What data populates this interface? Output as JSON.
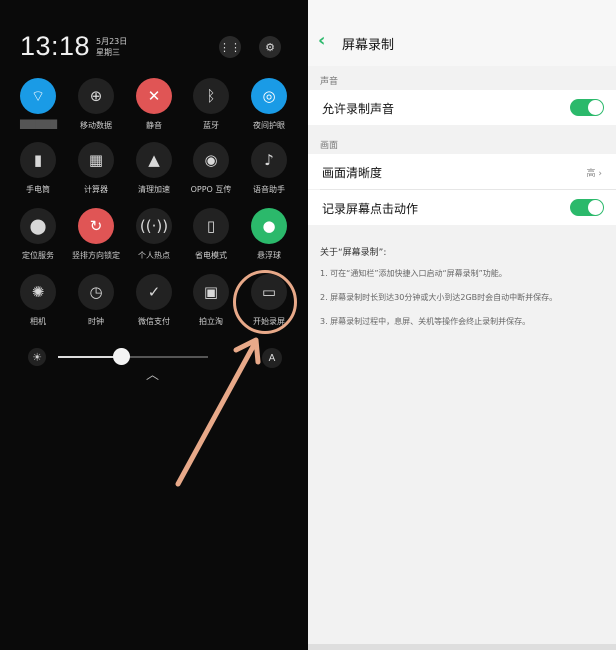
{
  "status": {
    "time": "13:18",
    "date": "5月23日",
    "weekday": "星期三"
  },
  "header_icons": [
    "grid-icon",
    "gear-icon"
  ],
  "tiles": [
    {
      "label": "███████",
      "icon": "wifi-icon",
      "color": "blue"
    },
    {
      "label": "移动数据",
      "icon": "globe-icon",
      "color": "dark"
    },
    {
      "label": "静音",
      "icon": "mute-icon",
      "color": "red"
    },
    {
      "label": "蓝牙",
      "icon": "bluetooth-icon",
      "color": "dark"
    },
    {
      "label": "夜间护眼",
      "icon": "night-eye-icon",
      "color": "blue"
    },
    {
      "label": "手电筒",
      "icon": "flashlight-icon",
      "color": "dark"
    },
    {
      "label": "计算器",
      "icon": "calculator-icon",
      "color": "dark"
    },
    {
      "label": "清理加速",
      "icon": "rocket-icon",
      "color": "dark"
    },
    {
      "label": "OPPO 互传",
      "icon": "share-icon",
      "color": "dark"
    },
    {
      "label": "语音助手",
      "icon": "microphone-icon",
      "color": "dark"
    },
    {
      "label": "定位服务",
      "icon": "location-icon",
      "color": "dark"
    },
    {
      "label": "竖排方向锁定",
      "icon": "rotation-lock-icon",
      "color": "red"
    },
    {
      "label": "个人热点",
      "icon": "hotspot-icon",
      "color": "dark"
    },
    {
      "label": "省电模式",
      "icon": "battery-icon",
      "color": "dark"
    },
    {
      "label": "悬浮球",
      "icon": "float-ball-icon",
      "color": "green"
    },
    {
      "label": "相机",
      "icon": "camera-aperture-icon",
      "color": "dark"
    },
    {
      "label": "时钟",
      "icon": "clock-icon",
      "color": "dark"
    },
    {
      "label": "微信支付",
      "icon": "wechat-pay-icon",
      "color": "dark"
    },
    {
      "label": "拍立淘",
      "icon": "camera-icon",
      "color": "dark"
    },
    {
      "label": "开始录屏",
      "icon": "screen-record-icon",
      "color": "dark"
    }
  ],
  "brightness": {
    "level_fraction": 0.42,
    "auto_label": "A"
  },
  "settings": {
    "title": "屏幕录制",
    "section_audio": "声音",
    "allow_audio_label": "允许录制声音",
    "allow_audio_on": true,
    "section_screen": "画面",
    "clarity_label": "画面清晰度",
    "clarity_value": "高",
    "record_taps_label": "记录屏幕点击动作",
    "record_taps_on": true,
    "about_title": "关于“屏幕录制”:",
    "about_items": [
      "1. 可在“通知栏”添加快捷入口启动“屏幕录制”功能。",
      "2. 屏幕录制时长到达30分钟或大小到达2GB时会自动中断并保存。",
      "3. 屏幕录制过程中，息屏、关机等操作会终止录制并保存。"
    ]
  },
  "colors": {
    "accent_green": "#2bb96b",
    "wifi_blue": "#1a9be6",
    "mute_red": "#e05555",
    "annotation": "#e8a989"
  }
}
